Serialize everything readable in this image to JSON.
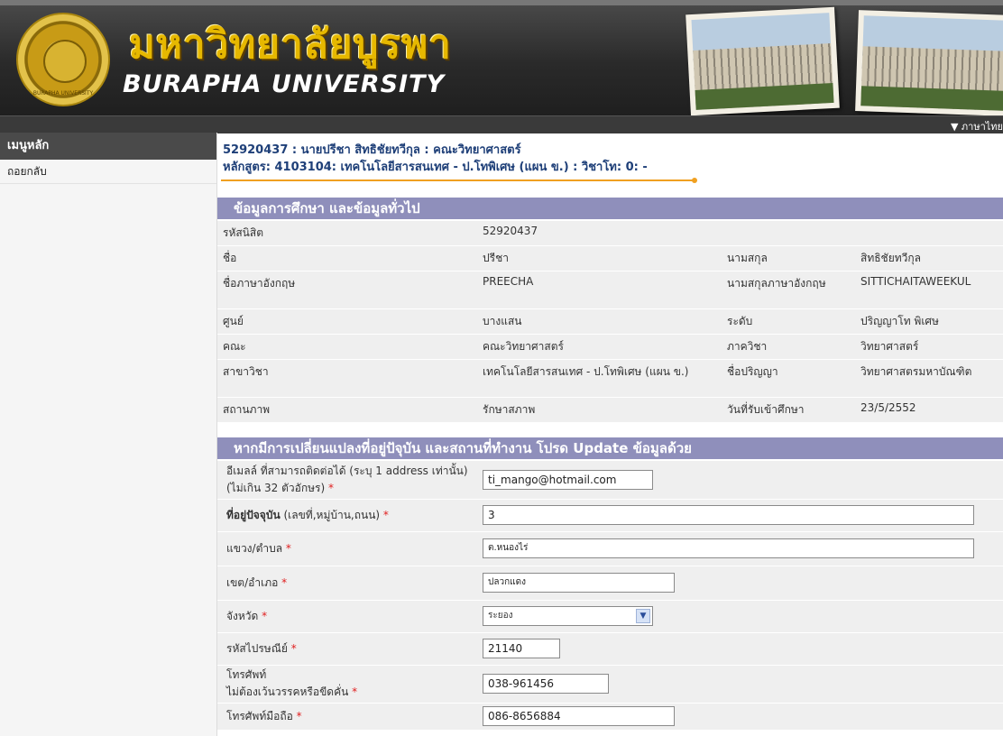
{
  "header": {
    "logo_text": "BURAPHA UNIVERSITY",
    "title_th": "มหาวิทยาลัยบูรพา",
    "title_en": "BURAPHA UNIVERSITY",
    "language_link": "▼ ภาษาไทย"
  },
  "sidebar": {
    "heading": "เมนูหลัก",
    "items": [
      {
        "label": "ถอยกลับ"
      }
    ]
  },
  "student": {
    "line1": "52920437 : นายปรีชา สิทธิชัยทวีกุล : คณะวิทยาศาสตร์",
    "line2": "หลักสูตร: 4103104: เทคโนโลยีสารสนเทศ - ป.โทพิเศษ (แผน ข.) : วิชาโท: 0: -"
  },
  "info_section": {
    "title": "ข้อมูลการศึกษา และข้อมูลทั่วไป",
    "rows": [
      {
        "l1": "รหัสนิสิต",
        "v1": "52920437",
        "l2": "",
        "v2": ""
      },
      {
        "l1": "ชื่อ",
        "v1": "ปรีชา",
        "l2": "นามสกุล",
        "v2": "สิทธิชัยทวีกุล"
      },
      {
        "l1": "ชื่อภาษาอังกฤษ",
        "v1": "PREECHA",
        "l2": "นามสกุลภาษาอังกฤษ",
        "v2": "SITTICHAITAWEEKUL"
      },
      {
        "l1": "ศูนย์",
        "v1": "บางแสน",
        "l2": "ระดับ",
        "v2": "ปริญญาโท พิเศษ"
      },
      {
        "l1": "คณะ",
        "v1": "คณะวิทยาศาสตร์",
        "l2": "ภาควิชา",
        "v2": "วิทยาศาสตร์"
      },
      {
        "l1": "สาขาวิชา",
        "v1": "เทคโนโลยีสารสนเทศ - ป.โทพิเศษ (แผน ข.)",
        "l2": "ชื่อปริญญา",
        "v2": "วิทยาศาสตรมหาบัณฑิต"
      },
      {
        "l1": "สถานภาพ",
        "v1": "รักษาสภาพ",
        "l2": "วันที่รับเข้าศึกษา",
        "v2": "23/5/2552"
      }
    ]
  },
  "update_section": {
    "title": "หากมีการเปลี่ยนแปลงที่อยู่ปัจุบัน และสถานที่ทำงาน โปรด Update ข้อมูลด้วย",
    "email_label": "อีเมลล์ ที่สามารถติดต่อได้ (ระบุ 1 address เท่านั้น) (ไม่เกิน 32 ตัวอักษร)",
    "email_value": "ti_mango@hotmail.com",
    "address_label_bold": "ที่อยู่ปัจจุบัน",
    "address_label_rest": " (เลขที่,หมู่บ้าน,ถนน)",
    "address_value": "3",
    "subdistrict_label": "แขวง/ตำบล",
    "subdistrict_value": "ต.หนองไร่",
    "district_label": "เขต/อำเภอ",
    "district_value": "ปลวกแดง",
    "province_label": "จังหวัด",
    "province_value": "ระยอง",
    "postal_label": "รหัสไปรษณีย์",
    "postal_value": "21140",
    "phone_label_1": "โทรศัพท์",
    "phone_label_2": "ไม่ต้องเว้นวรรคหรือขีดคั่น",
    "phone_value": "038-961456",
    "mobile_label": "โทรศัพท์มือถือ",
    "mobile_value": "086-8656884",
    "required_mark": "*"
  },
  "colors": {
    "section_header": "#8f8fbb",
    "student_text": "#1e3f78",
    "accent_line": "#f0a020",
    "required": "#e02020"
  }
}
